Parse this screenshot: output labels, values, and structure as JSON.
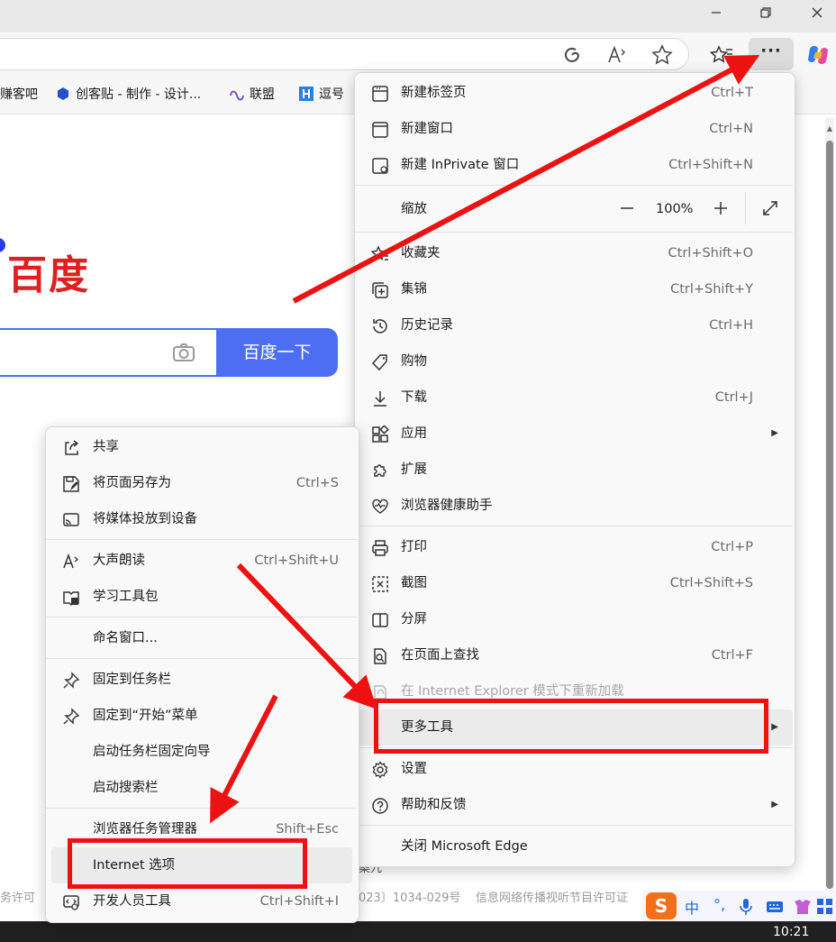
{
  "bookmarks": [
    {
      "label": "赚客吧",
      "icon": "bookmark-icon"
    },
    {
      "label": "创客贴 - 制作 - 设计...",
      "icon": "chuangketie-icon"
    },
    {
      "label": "联盟",
      "icon": "meta-icon"
    },
    {
      "label": "逗号",
      "icon": "h-icon"
    }
  ],
  "page": {
    "logo_text": "百度",
    "search_button": "百度一下",
    "footer_left": "务许可",
    "footer_mid": "023〕1034-029号",
    "footer_right": "信息网络传播视听节目许可证",
    "footer_under_menu": "案九"
  },
  "main_menu": {
    "items": [
      {
        "label": "新建标签页",
        "shortcut": "Ctrl+T",
        "icon": "new-tab-icon"
      },
      {
        "label": "新建窗口",
        "shortcut": "Ctrl+N",
        "icon": "new-window-icon"
      },
      {
        "label": "新建 InPrivate 窗口",
        "shortcut": "Ctrl+Shift+N",
        "icon": "inprivate-icon"
      },
      {
        "label": "缩放",
        "icon": "zoom-icon"
      },
      {
        "label": "收藏夹",
        "shortcut": "Ctrl+Shift+O",
        "icon": "favorites-icon"
      },
      {
        "label": "集锦",
        "shortcut": "Ctrl+Shift+Y",
        "icon": "collections-icon"
      },
      {
        "label": "历史记录",
        "shortcut": "Ctrl+H",
        "icon": "history-icon"
      },
      {
        "label": "购物",
        "icon": "shopping-icon"
      },
      {
        "label": "下载",
        "shortcut": "Ctrl+J",
        "icon": "download-icon"
      },
      {
        "label": "应用",
        "icon": "apps-icon"
      },
      {
        "label": "扩展",
        "icon": "extensions-icon"
      },
      {
        "label": "浏览器健康助手",
        "icon": "health-icon"
      },
      {
        "label": "打印",
        "shortcut": "Ctrl+P",
        "icon": "print-icon"
      },
      {
        "label": "截图",
        "shortcut": "Ctrl+Shift+S",
        "icon": "screenshot-icon"
      },
      {
        "label": "分屏",
        "icon": "split-screen-icon"
      },
      {
        "label": "在页面上查找",
        "shortcut": "Ctrl+F",
        "icon": "find-icon"
      },
      {
        "label": "在 Internet Explorer 模式下重新加载",
        "icon": "ie-icon"
      },
      {
        "label": "更多工具",
        "icon": "more-tools-icon"
      },
      {
        "label": "设置",
        "icon": "settings-icon"
      },
      {
        "label": "帮助和反馈",
        "icon": "help-icon"
      },
      {
        "label": "关闭 Microsoft Edge",
        "icon": "close-edge-icon"
      }
    ],
    "zoom_value": "100%"
  },
  "sub_menu": {
    "items": [
      {
        "label": "共享",
        "icon": "share-icon"
      },
      {
        "label": "将页面另存为",
        "shortcut": "Ctrl+S",
        "icon": "save-page-icon"
      },
      {
        "label": "将媒体投放到设备",
        "icon": "cast-icon"
      },
      {
        "label": "大声朗读",
        "shortcut": "Ctrl+Shift+U",
        "icon": "read-aloud-icon"
      },
      {
        "label": "学习工具包",
        "icon": "learning-toolkit-icon"
      },
      {
        "label": "命名窗口..."
      },
      {
        "label": "固定到任务栏",
        "icon": "pin-icon"
      },
      {
        "label": "固定到“开始”菜单",
        "icon": "pin-start-icon"
      },
      {
        "label": "启动任务栏固定向导"
      },
      {
        "label": "启动搜索栏"
      },
      {
        "label": "浏览器任务管理器",
        "shortcut": "Shift+Esc"
      },
      {
        "label": "Internet 选项"
      },
      {
        "label": "开发人员工具",
        "shortcut": "Ctrl+Shift+I",
        "icon": "devtools-icon"
      }
    ]
  },
  "ime": {
    "lang": "中",
    "punct": "°,"
  },
  "taskbar": {
    "time": "10:21"
  },
  "colors": {
    "annotation_red": "#ee1111",
    "baidu_blue": "#4e6ef2",
    "baidu_red": "#e02020"
  }
}
